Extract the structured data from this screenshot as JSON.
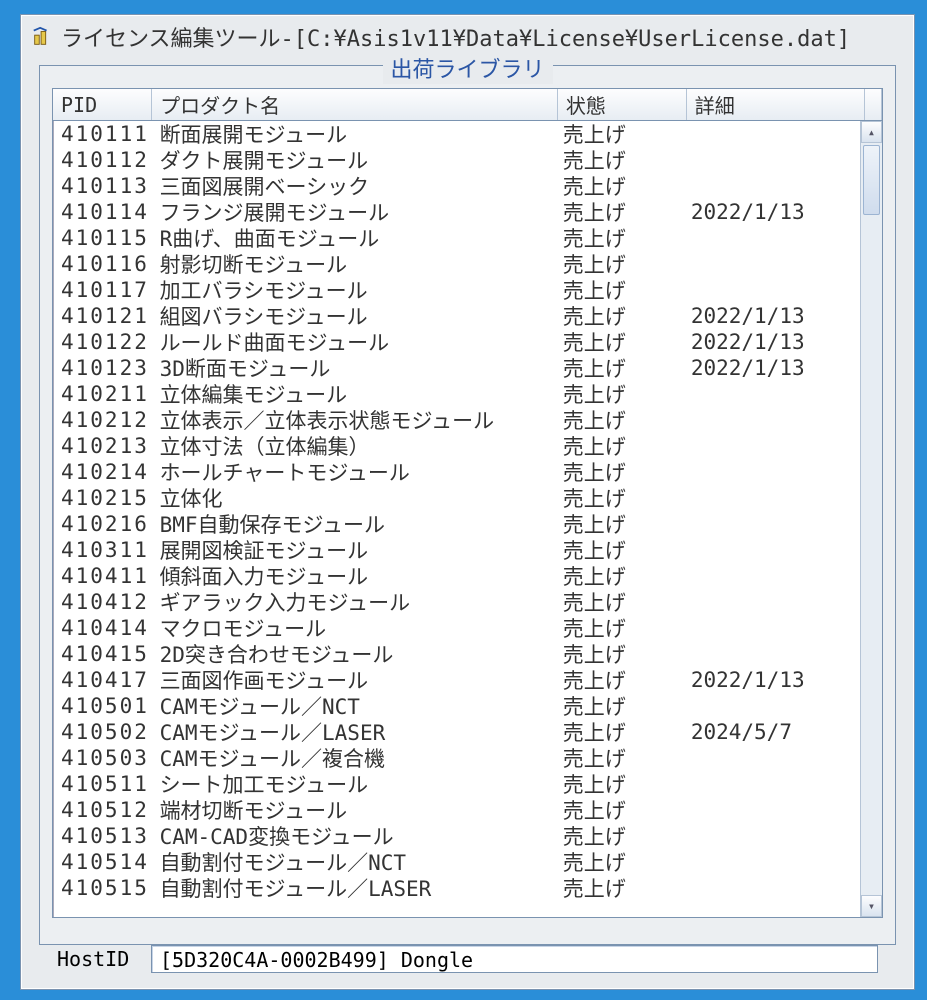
{
  "window": {
    "title": "ライセンス編集ツール-[C:¥Asis1v11¥Data¥License¥UserLicense.dat]"
  },
  "group": {
    "title": "出荷ライブラリ"
  },
  "columns": {
    "pid": "PID",
    "name": "プロダクト名",
    "status": "状態",
    "detail": "詳細"
  },
  "rows": [
    {
      "pid": "410111",
      "name": "断面展開モジュール",
      "status": "売上げ",
      "detail": ""
    },
    {
      "pid": "410112",
      "name": "ダクト展開モジュール",
      "status": "売上げ",
      "detail": ""
    },
    {
      "pid": "410113",
      "name": "三面図展開ベーシック",
      "status": "売上げ",
      "detail": ""
    },
    {
      "pid": "410114",
      "name": "フランジ展開モジュール",
      "status": "売上げ",
      "detail": "2022/1/13"
    },
    {
      "pid": "410115",
      "name": "R曲げ、曲面モジュール",
      "status": "売上げ",
      "detail": ""
    },
    {
      "pid": "410116",
      "name": "射影切断モジュール",
      "status": "売上げ",
      "detail": ""
    },
    {
      "pid": "410117",
      "name": "加工バラシモジュール",
      "status": "売上げ",
      "detail": ""
    },
    {
      "pid": "410121",
      "name": "組図バラシモジュール",
      "status": "売上げ",
      "detail": "2022/1/13"
    },
    {
      "pid": "410122",
      "name": "ルールド曲面モジュール",
      "status": "売上げ",
      "detail": "2022/1/13"
    },
    {
      "pid": "410123",
      "name": "3D断面モジュール",
      "status": "売上げ",
      "detail": "2022/1/13"
    },
    {
      "pid": "410211",
      "name": "立体編集モジュール",
      "status": "売上げ",
      "detail": ""
    },
    {
      "pid": "410212",
      "name": "立体表示／立体表示状態モジュール",
      "status": "売上げ",
      "detail": ""
    },
    {
      "pid": "410213",
      "name": "立体寸法（立体編集）",
      "status": "売上げ",
      "detail": ""
    },
    {
      "pid": "410214",
      "name": "ホールチャートモジュール",
      "status": "売上げ",
      "detail": ""
    },
    {
      "pid": "410215",
      "name": "立体化",
      "status": "売上げ",
      "detail": ""
    },
    {
      "pid": "410216",
      "name": "BMF自動保存モジュール",
      "status": "売上げ",
      "detail": ""
    },
    {
      "pid": "410311",
      "name": "展開図検証モジュール",
      "status": "売上げ",
      "detail": ""
    },
    {
      "pid": "410411",
      "name": "傾斜面入力モジュール",
      "status": "売上げ",
      "detail": ""
    },
    {
      "pid": "410412",
      "name": "ギアラック入力モジュール",
      "status": "売上げ",
      "detail": ""
    },
    {
      "pid": "410414",
      "name": "マクロモジュール",
      "status": "売上げ",
      "detail": ""
    },
    {
      "pid": "410415",
      "name": "2D突き合わせモジュール",
      "status": "売上げ",
      "detail": ""
    },
    {
      "pid": "410417",
      "name": "三面図作画モジュール",
      "status": "売上げ",
      "detail": "2022/1/13"
    },
    {
      "pid": "410501",
      "name": "CAMモジュール／NCT",
      "status": "売上げ",
      "detail": ""
    },
    {
      "pid": "410502",
      "name": "CAMモジュール／LASER",
      "status": "売上げ",
      "detail": "2024/5/7"
    },
    {
      "pid": "410503",
      "name": "CAMモジュール／複合機",
      "status": "売上げ",
      "detail": ""
    },
    {
      "pid": "410511",
      "name": "シート加工モジュール",
      "status": "売上げ",
      "detail": ""
    },
    {
      "pid": "410512",
      "name": "端材切断モジュール",
      "status": "売上げ",
      "detail": ""
    },
    {
      "pid": "410513",
      "name": "CAM-CAD変換モジュール",
      "status": "売上げ",
      "detail": ""
    },
    {
      "pid": "410514",
      "name": "自動割付モジュール／NCT",
      "status": "売上げ",
      "detail": ""
    },
    {
      "pid": "410515",
      "name": "自動割付モジュール／LASER",
      "status": "売上げ",
      "detail": ""
    }
  ],
  "status": {
    "label": "HostID",
    "value": "[5D320C4A-0002B499] Dongle"
  }
}
